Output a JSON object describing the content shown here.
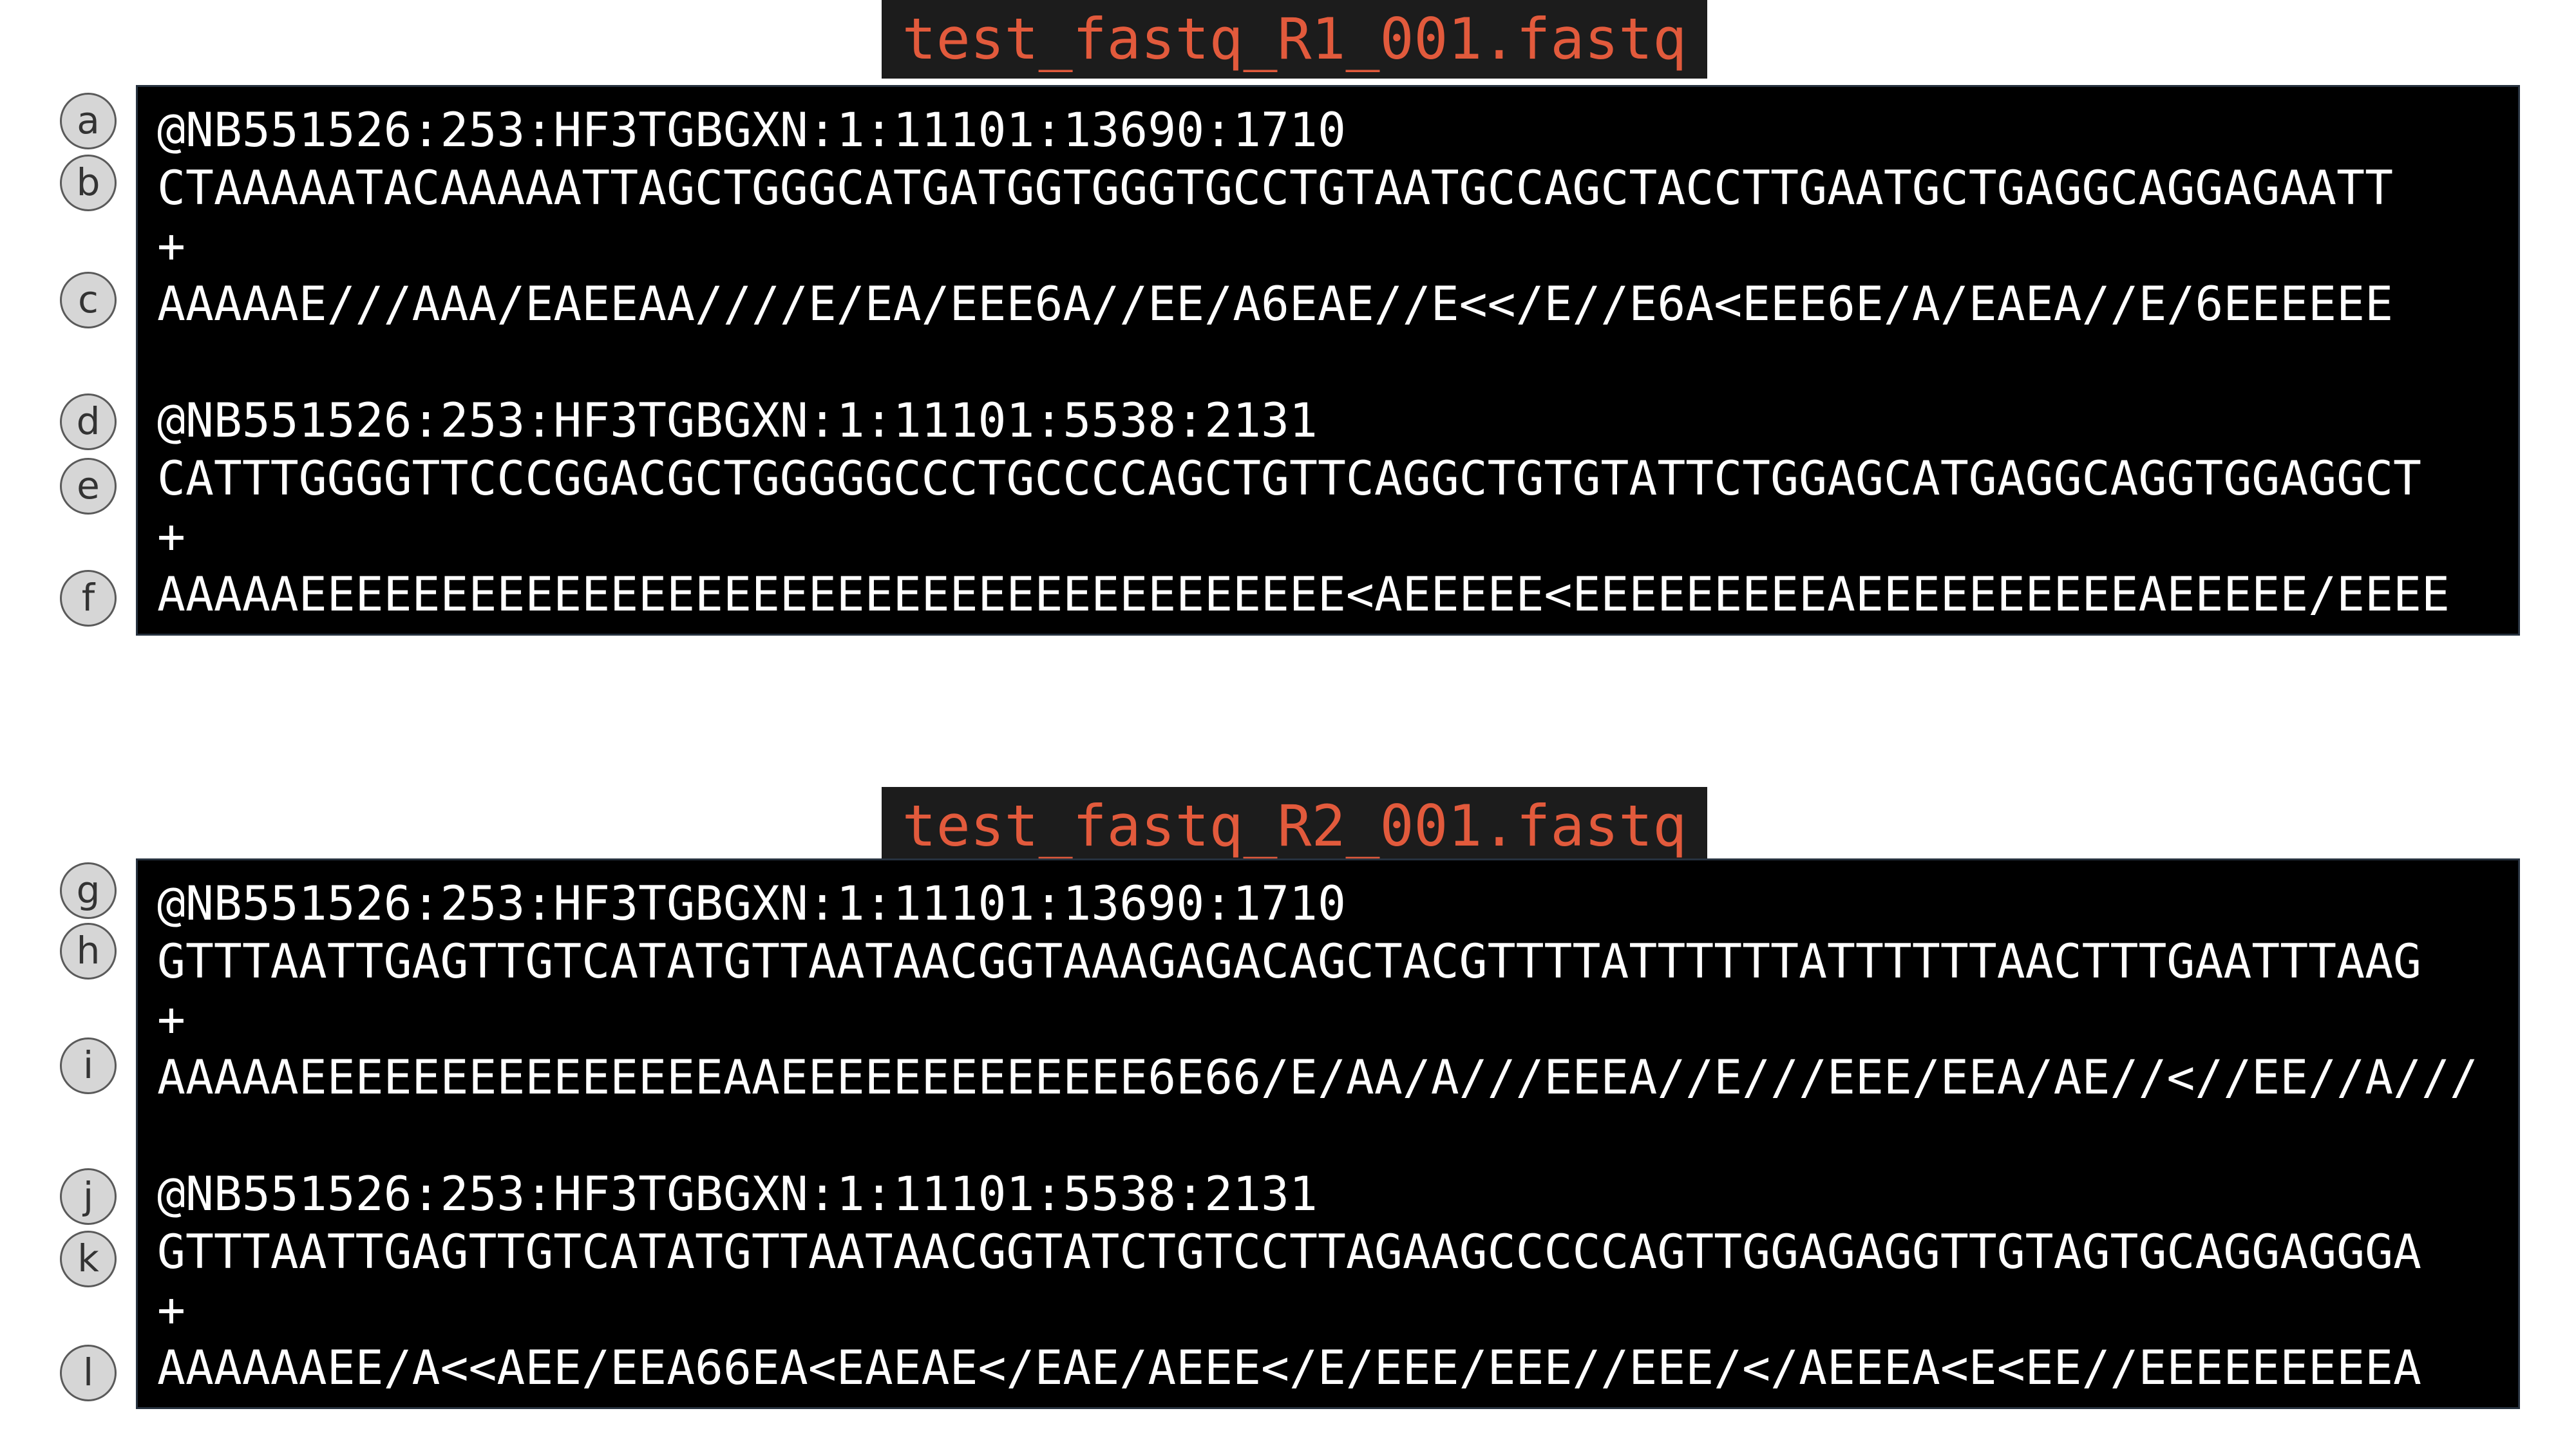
{
  "files": [
    {
      "title": "test_fastq_R1_001.fastq",
      "records": [
        {
          "header": "@NB551526:253:HF3TGBGXN:1:11101:13690:1710",
          "sequence": "CTAAAAATACAAAAATTAGCTGGGCATGATGGTGGGTGCCTGTAATGCCAGCTACCTTGAATGCTGAGGCAGGAGAATT",
          "separator": "+",
          "quality": "AAAAAE///AAA/EAEEAA////E/EA/EEE6A//EE/A6EAE//E<</E//E6A<EEE6E/A/EAEA//E/6EEEEEE"
        },
        {
          "header": "@NB551526:253:HF3TGBGXN:1:11101:5538:2131",
          "sequence": "CATTTGGGGTTCCCGGACGCTGGGGGCCCTGCCCCAGCTGTTCAGGCTGTGTATTCTGGAGCATGAGGCAGGTGGAGGCT",
          "separator": "+",
          "quality": "AAAAAEEEEEEEEEEEEEEEEEEEEEEEEEEEEEEEEEEEEE<AEEEEE<EEEEEEEEEAEEEEEEEEEEAEEEEE/EEEE"
        }
      ]
    },
    {
      "title": "test_fastq_R2_001.fastq",
      "records": [
        {
          "header": "@NB551526:253:HF3TGBGXN:1:11101:13690:1710",
          "sequence": "GTTTAATTGAGTTGTCATATGTTAATAACGGTAAAGAGACAGCTACGTTTTATTTTTTATTTTTTAACTTTGAATTTAAG",
          "separator": "+",
          "quality": "AAAAAEEEEEEEEEEEEEEEAAEEEEEEEEEEEEE6E66/E/AA/A///EEEA//E///EEE/EEA/AE//<//EE//A///"
        },
        {
          "header": "@NB551526:253:HF3TGBGXN:1:11101:5538:2131",
          "sequence": "GTTTAATTGAGTTGTCATATGTTAATAACGGTATCTGTCCTTAGAAGCCCCCAGTTGGAGAGGTTGTAGTGCAGGAGGGA",
          "separator": "+",
          "quality": "AAAAAAEE/A<<AEE/EEA66EA<EAEAE</EAE/AEEE</E/EEE/EEE//EEE/</AEEEA<E<EE//EEEEEEEEEA"
        }
      ]
    }
  ],
  "markers": [
    "a",
    "b",
    "c",
    "d",
    "e",
    "f",
    "g",
    "h",
    "i",
    "j",
    "k",
    "l"
  ],
  "colors": {
    "title_text": "#e25a3c",
    "title_background": "#1c1c1c",
    "terminal_background": "#000000",
    "terminal_text": "#ffffff",
    "marker_fill": "#d6d6d6"
  }
}
